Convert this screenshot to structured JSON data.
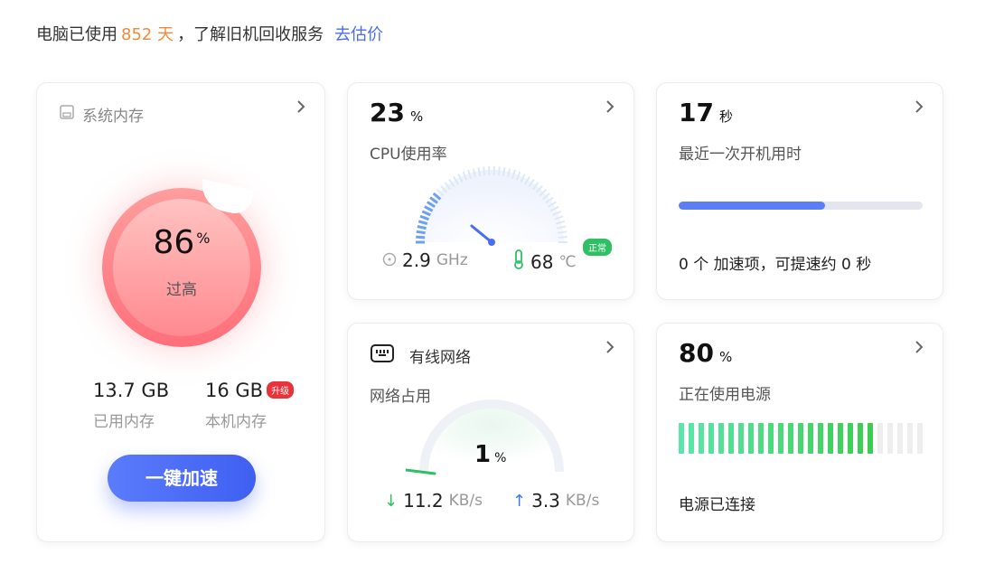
{
  "topbar": {
    "prefix": "电脑已使用",
    "days": "852 天",
    "suffix": "，了解旧机回收服务",
    "link": "去估价"
  },
  "memory": {
    "title": "系统内存",
    "percent": "86",
    "percent_unit": "%",
    "status": "过高",
    "used_value": "13.7 GB",
    "used_label": "已用内存",
    "total_value": "16 GB",
    "upgrade_badge": "升级",
    "total_label": "本机内存",
    "boost_button": "一键加速",
    "color_accent": "#ff6f7a"
  },
  "cpu": {
    "percent": "23",
    "unit": "%",
    "label": "CPU使用率",
    "freq_value": "2.9",
    "freq_unit": "GHz",
    "temp_value": "68",
    "temp_unit": "℃",
    "temp_badge": "正常",
    "usage_fraction": 0.23
  },
  "boot": {
    "seconds": "17",
    "unit": "秒",
    "label": "最近一次开机用时",
    "progress_fraction": 0.6,
    "note": "0 个 加速项，可提速约 0 秒"
  },
  "network": {
    "title": "有线网络",
    "label": "网络占用",
    "percent": "1",
    "unit": "%",
    "down_value": "11.2",
    "down_unit": "KB/s",
    "up_value": "3.3",
    "up_unit": "KB/s"
  },
  "power": {
    "percent": "80",
    "unit": "%",
    "label": "正在使用电源",
    "level_fraction": 0.8,
    "status": "电源已连接"
  }
}
